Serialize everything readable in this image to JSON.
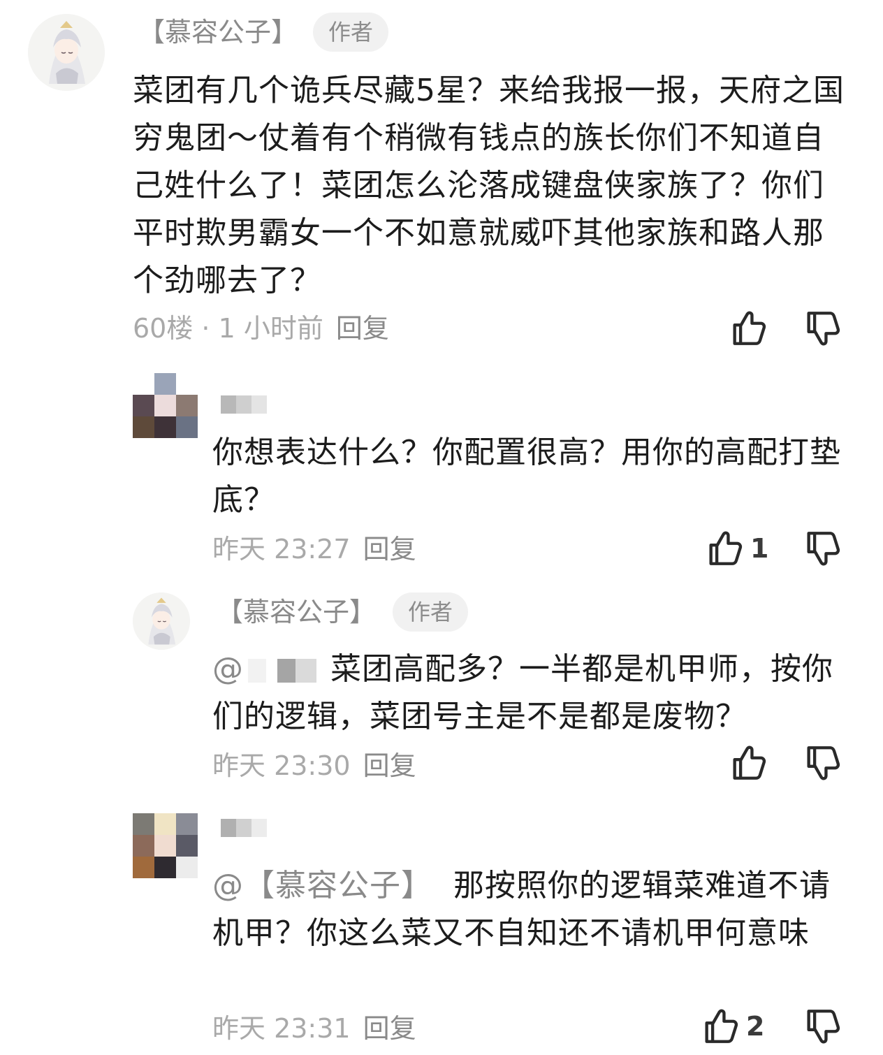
{
  "comments": [
    {
      "author": "【慕容公子】",
      "badge": "作者",
      "text": "菜团有几个诡兵尽藏5星？来给我报一报，天府之国穷鬼团～仗着有个稍微有钱点的族长你们不知道自己姓什么了！菜团怎么沦落成键盘侠家族了？你们平时欺男霸女一个不如意就威吓其他家族和路人那个劲哪去了？",
      "floor": "60楼 · 1 小时前",
      "reply": "回复",
      "like_icon": "thumb-up-icon",
      "dislike_icon": "thumb-down-icon"
    },
    {
      "text": "你想表达什么？你配置很高？用你的高配打垫底？",
      "time": "昨天 23:27",
      "reply": "回复",
      "likes": "1"
    },
    {
      "author": "【慕容公子】",
      "badge": "作者",
      "mention": "@",
      "text": "菜团高配多？一半都是机甲师，按你们的逻辑，菜团号主是不是都是废物？",
      "time": "昨天 23:30",
      "reply": "回复"
    },
    {
      "mention": "@【慕容公子】",
      "text": "那按照你的逻辑菜难道不请机甲？你这么菜又不自知还不请机甲何意味",
      "time": "昨天 23:31",
      "reply": "回复",
      "likes": "2"
    }
  ],
  "colors": {
    "meta": "#a9a9a9",
    "name": "#8a8a8a",
    "badge_bg": "#f1f1f1",
    "icon": "#2a2a2a"
  }
}
